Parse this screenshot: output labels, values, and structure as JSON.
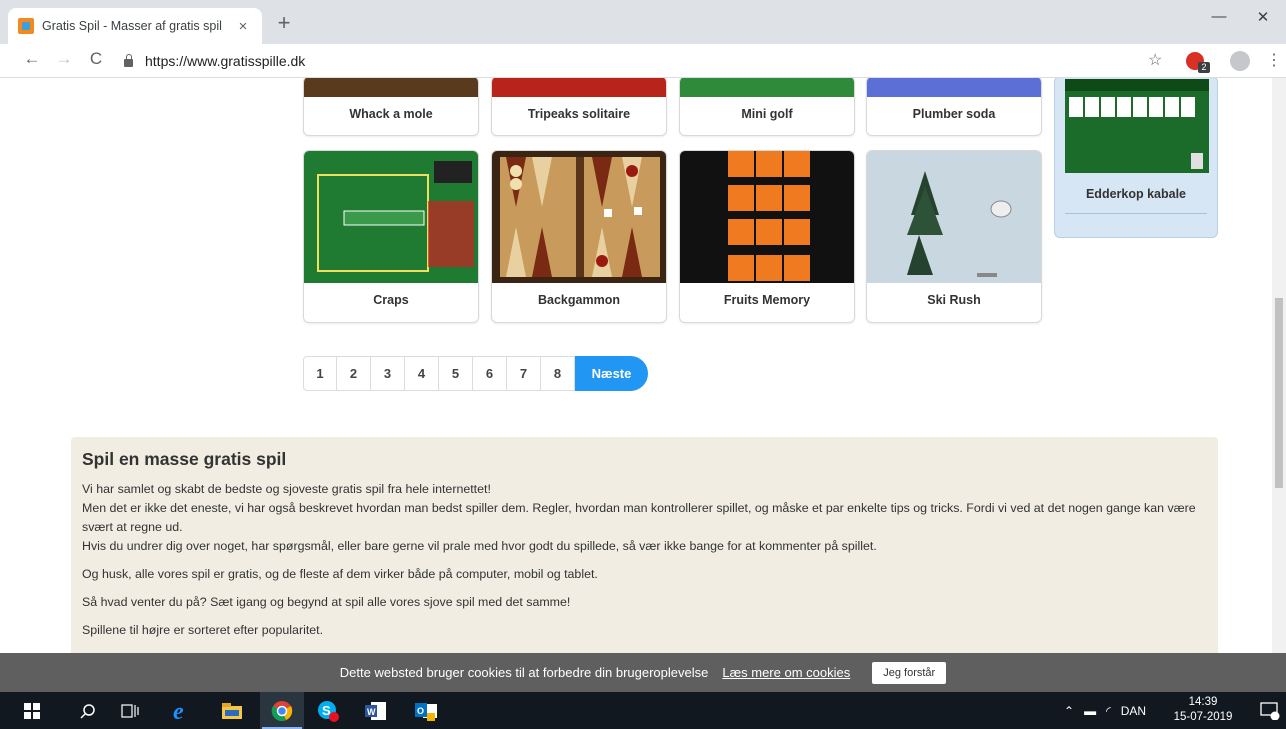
{
  "browser": {
    "tab_title": "Gratis Spil - Masser af gratis spil",
    "tab_close": "×",
    "new_tab": "+",
    "url": "https://www.gratisspille.dk",
    "back": "←",
    "forward": "→",
    "reload": "C",
    "bookmark": "☆",
    "extension_badge": "2",
    "menu": "⋮",
    "minimize": "—",
    "restore": "❐",
    "close": "✕"
  },
  "games_top_row": [
    {
      "name": "Whack a mole",
      "color": "#5a3a1c"
    },
    {
      "name": "Tripeaks solitaire",
      "color": "#b8241b"
    },
    {
      "name": "Mini golf",
      "color": "#2f8a3a"
    },
    {
      "name": "Plumber soda",
      "color": "#5c6fd6"
    }
  ],
  "games_row": [
    {
      "name": "Craps",
      "color": "#1f7a32"
    },
    {
      "name": "Backgammon",
      "color": "#8a5a2c"
    },
    {
      "name": "Fruits Memory",
      "color": "#f07a1f"
    },
    {
      "name": "Ski Rush",
      "color": "#c9d8e0"
    }
  ],
  "side_game": {
    "name": "Edderkop kabale",
    "color": "#1b6b2a"
  },
  "pagination": {
    "pages": [
      "1",
      "2",
      "3",
      "4",
      "5",
      "6",
      "7",
      "8"
    ],
    "next_label": "Næste"
  },
  "info": {
    "heading": "Spil en masse gratis spil",
    "p1_line1": "Vi har samlet og skabt de bedste og sjoveste gratis spil fra hele internettet!",
    "p1_line2": "Men det er ikke det eneste, vi har også beskrevet hvordan man bedst spiller dem. Regler, hvordan man kontrollerer spillet, og måske et par enkelte tips og tricks. Fordi vi ved at det nogen gange kan være svært at regne ud.",
    "p1_line3": "Hvis du undrer dig over noget, har spørgsmål, eller bare gerne vil prale med hvor godt du spillede, så vær ikke bange for at kommenter på spillet.",
    "p2": "Og husk, alle vores spil er gratis, og de fleste af dem virker både på computer, mobil og tablet.",
    "p3": "Så hvad venter du på? Sæt igang og begynd at spil alle vores sjove spil med det samme!",
    "p4": "Spillene til højre er sorteret efter popularitet."
  },
  "cookie": {
    "text": "Dette websted bruger cookies til at forbedre din brugeroplevelse",
    "more_link": "Læs mere om cookies",
    "accept_button": "Jeg forstår"
  },
  "taskbar": {
    "language": "DAN",
    "time": "14:39",
    "date": "15-07-2019",
    "notification_count": "1"
  }
}
